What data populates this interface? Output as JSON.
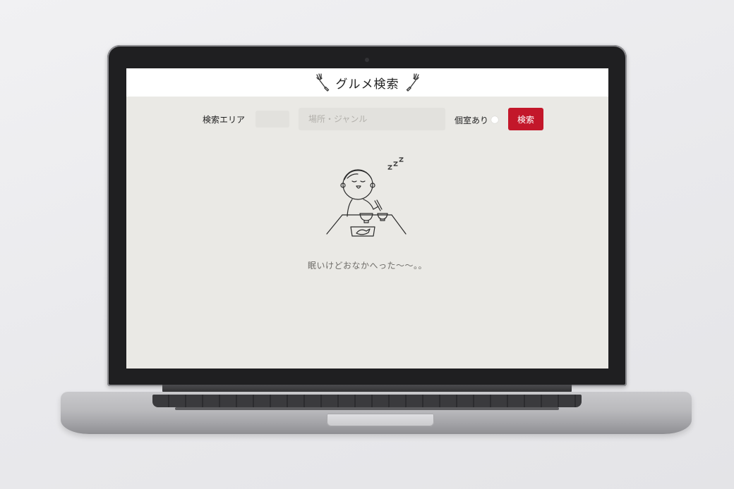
{
  "header": {
    "title": "グルメ検索",
    "left_icon": "fork-icon",
    "right_icon": "fork-icon"
  },
  "search": {
    "area_label": "検索エリア",
    "area_value": "",
    "keyword_placeholder": "場所・ジャンル",
    "keyword_value": "",
    "private_room_label": "個室あり",
    "private_room_checked": false,
    "button_label": "検索"
  },
  "empty_state": {
    "icon": "sleepy-person-eating-illustration",
    "message": "眠いけどおなかへった〜〜。。"
  },
  "colors": {
    "accent": "#c3172a",
    "page_background": "#eae9e5",
    "header_background": "#ffffff"
  }
}
